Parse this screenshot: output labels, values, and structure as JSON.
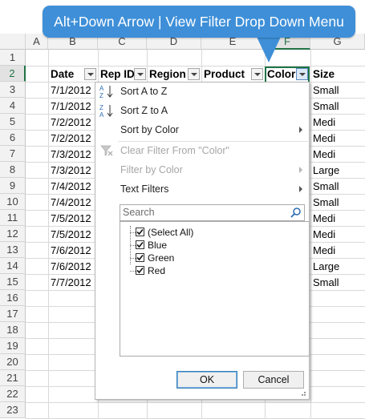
{
  "banner": {
    "text": "Alt+Down Arrow | View Filter Drop Down Menu",
    "color": "#3e8fd8"
  },
  "columns": [
    "A",
    "B",
    "C",
    "D",
    "E",
    "F",
    "G"
  ],
  "selected_column": "F",
  "rows": [
    "1",
    "2",
    "3",
    "4",
    "5",
    "6",
    "7",
    "8",
    "9",
    "10",
    "11",
    "12",
    "13",
    "14",
    "15",
    "16",
    "17",
    "18",
    "19",
    "20",
    "21",
    "22",
    "23"
  ],
  "selected_row": "2",
  "headers": {
    "date": "Date",
    "rep_id": "Rep ID",
    "region": "Region",
    "product": "Product",
    "color": "Color",
    "size": "Size"
  },
  "data": {
    "dates": [
      "7/1/2012",
      "7/1/2012",
      "7/2/2012",
      "7/2/2012",
      "7/3/2012",
      "7/3/2012",
      "7/4/2012",
      "7/4/2012",
      "7/5/2012",
      "7/5/2012",
      "7/6/2012",
      "7/6/2012",
      "7/7/2012"
    ],
    "sizes": [
      "Small",
      "Small",
      "Medi",
      "Medi",
      "Medi",
      "Large",
      "Small",
      "Small",
      "Medi",
      "Medi",
      "Medi",
      "Large",
      "Small"
    ]
  },
  "menu": {
    "sort_az": "Sort A to Z",
    "sort_za": "Sort Z to A",
    "sort_by_color": "Sort by Color",
    "clear_filter": "Clear Filter From \"Color\"",
    "filter_by_color": "Filter by Color",
    "text_filters": "Text Filters",
    "search_placeholder": "Search",
    "list": [
      {
        "label": "(Select All)",
        "checked": true
      },
      {
        "label": "Blue",
        "checked": true
      },
      {
        "label": "Green",
        "checked": true
      },
      {
        "label": "Red",
        "checked": true
      }
    ],
    "ok": "OK",
    "cancel": "Cancel"
  },
  "accent_color": "#217346"
}
